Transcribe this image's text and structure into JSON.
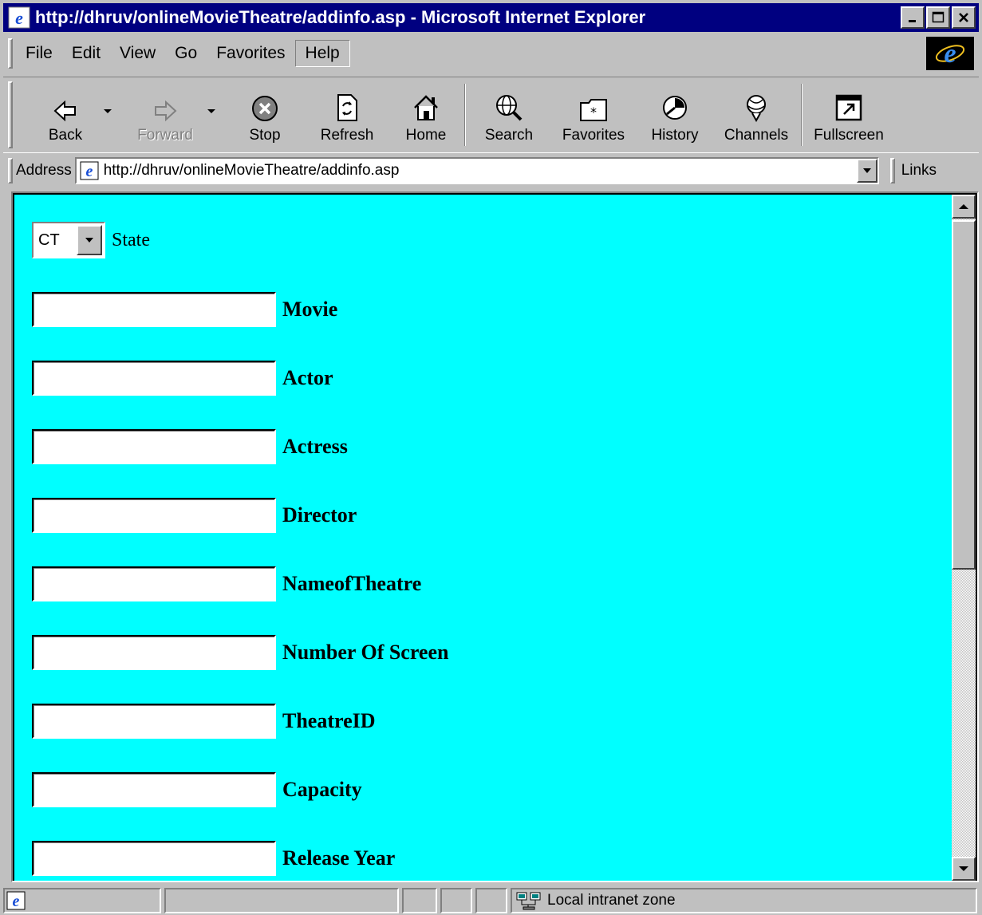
{
  "window": {
    "title": "http://dhruv/onlineMovieTheatre/addinfo.asp - Microsoft Internet Explorer",
    "controls": [
      "minimize",
      "maximize",
      "close"
    ]
  },
  "menu": {
    "items": [
      {
        "label": "File"
      },
      {
        "label": "Edit"
      },
      {
        "label": "View"
      },
      {
        "label": "Go"
      },
      {
        "label": "Favorites"
      },
      {
        "label": "Help"
      }
    ],
    "pressed": "Help"
  },
  "toolbar": {
    "buttons": [
      {
        "label": "Back",
        "icon": "back-arrow-icon"
      },
      {
        "label": "Forward",
        "icon": "forward-arrow-icon",
        "disabled": true
      },
      {
        "label": "Stop",
        "icon": "stop-icon"
      },
      {
        "label": "Refresh",
        "icon": "refresh-icon"
      },
      {
        "label": "Home",
        "icon": "home-icon"
      },
      {
        "label": "Search",
        "icon": "search-globe-icon"
      },
      {
        "label": "Favorites",
        "icon": "favorites-folder-icon"
      },
      {
        "label": "History",
        "icon": "history-icon"
      },
      {
        "label": "Channels",
        "icon": "channels-icon"
      },
      {
        "label": "Fullscreen",
        "icon": "fullscreen-icon"
      }
    ]
  },
  "address": {
    "label": "Address",
    "url": "http://dhruv/onlineMovieTheatre/addinfo.asp",
    "links_label": "Links"
  },
  "form": {
    "state": {
      "selected": "CT",
      "label": "State"
    },
    "fields": [
      {
        "label": "Movie",
        "value": ""
      },
      {
        "label": "Actor",
        "value": ""
      },
      {
        "label": "Actress",
        "value": ""
      },
      {
        "label": "Director",
        "value": ""
      },
      {
        "label": "NameofTheatre",
        "value": ""
      },
      {
        "label": "Number Of Screen",
        "value": ""
      },
      {
        "label": "TheatreID",
        "value": ""
      },
      {
        "label": "Capacity",
        "value": ""
      },
      {
        "label": "Release Year",
        "value": ""
      }
    ],
    "background": "#00ffff"
  },
  "status": {
    "zone": "Local intranet zone"
  },
  "colors": {
    "titlebar": "#000080",
    "chrome": "#c0c0c0",
    "page_background": "#00ffff"
  }
}
